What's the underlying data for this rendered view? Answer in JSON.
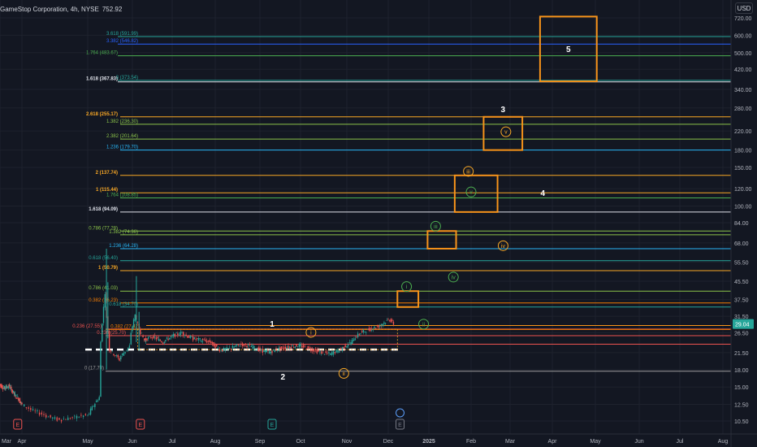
{
  "header": {
    "symbol": "GameStop Corporation, 4h, NYSE",
    "last_value": "752.92"
  },
  "currency_button": "USD",
  "current_price_label": "29.04",
  "colors": {
    "background": "#131722",
    "grid": "#1e222d",
    "orange": "#f7931a",
    "green": "#26a69a",
    "red": "#ef5350"
  },
  "chart_data": {
    "type": "candlestick",
    "price_scale": "log",
    "y_ticks": [
      "720.00",
      "600.00",
      "500.00",
      "420.00",
      "340.00",
      "280.00",
      "220.00",
      "180.00",
      "150.00",
      "120.00",
      "100.00",
      "84.00",
      "68.00",
      "55.50",
      "45.50",
      "37.50",
      "31.50",
      "26.50",
      "21.50",
      "18.00",
      "15.00",
      "12.50",
      "10.50"
    ],
    "x_ticks": [
      "Mar",
      "Apr",
      "May",
      "Jun",
      "Jul",
      "Aug",
      "Sep",
      "Oct",
      "Nov",
      "Dec",
      "2025",
      "Feb",
      "Mar",
      "Apr",
      "May",
      "Jun",
      "Jul",
      "Aug"
    ],
    "price_path": [
      [
        "2024-03-01",
        15.5
      ],
      [
        "2024-03-08",
        14.8
      ],
      [
        "2024-03-15",
        15.2
      ],
      [
        "2024-03-22",
        14.0
      ],
      [
        "2024-03-29",
        13.2
      ],
      [
        "2024-04-05",
        12.0
      ],
      [
        "2024-04-12",
        11.2
      ],
      [
        "2024-04-19",
        10.6
      ],
      [
        "2024-04-26",
        10.9
      ],
      [
        "2024-05-03",
        11.2
      ],
      [
        "2024-05-10",
        13.5
      ],
      [
        "2024-05-14",
        40.0
      ],
      [
        "2024-05-17",
        22.5
      ],
      [
        "2024-05-24",
        20.0
      ],
      [
        "2024-05-31",
        23.0
      ],
      [
        "2024-06-04",
        32.0
      ],
      [
        "2024-06-07",
        28.0
      ],
      [
        "2024-06-11",
        24.5
      ],
      [
        "2024-06-18",
        25.5
      ],
      [
        "2024-06-25",
        24.0
      ],
      [
        "2024-07-02",
        25.5
      ],
      [
        "2024-07-09",
        26.5
      ],
      [
        "2024-07-16",
        25.0
      ],
      [
        "2024-07-23",
        24.5
      ],
      [
        "2024-07-30",
        24.0
      ],
      [
        "2024-08-06",
        22.0
      ],
      [
        "2024-08-13",
        22.5
      ],
      [
        "2024-08-20",
        23.5
      ],
      [
        "2024-08-27",
        23.0
      ],
      [
        "2024-09-03",
        22.0
      ],
      [
        "2024-09-10",
        21.6
      ],
      [
        "2024-09-17",
        22.5
      ],
      [
        "2024-09-24",
        22.8
      ],
      [
        "2024-10-01",
        23.2
      ],
      [
        "2024-10-08",
        22.5
      ],
      [
        "2024-10-15",
        21.6
      ],
      [
        "2024-10-22",
        21.2
      ],
      [
        "2024-10-29",
        22.2
      ],
      [
        "2024-11-05",
        24.0
      ],
      [
        "2024-11-12",
        26.5
      ],
      [
        "2024-11-19",
        27.5
      ],
      [
        "2024-11-26",
        28.5
      ],
      [
        "2024-12-03",
        30.5
      ],
      [
        "2024-12-06",
        29.04
      ]
    ],
    "fib_levels": [
      {
        "label": "3.618 (591.99)",
        "price": 592,
        "color": "#26a69a"
      },
      {
        "label": "3.382 (546.82)",
        "price": 547,
        "color": "#2962ff"
      },
      {
        "label": "1.764 (483.67)",
        "price": 484,
        "color": "#4caf50"
      },
      {
        "label": "1.618 (367.83)",
        "price": 368,
        "color": "#e0e3eb"
      },
      {
        "label": "3 (373.54)",
        "price": 374,
        "color": "#26a69a"
      },
      {
        "label": "2.618 (255.17)",
        "price": 255,
        "color": "#f9a825"
      },
      {
        "label": "1.382 (236.30)",
        "price": 236,
        "color": "#8bc34a"
      },
      {
        "label": "2.382 (201.64)",
        "price": 202,
        "color": "#8bc34a"
      },
      {
        "label": "1.236 (179.70)",
        "price": 180,
        "color": "#29b6f6"
      },
      {
        "label": "2 (137.74)",
        "price": 138,
        "color": "#f9a825"
      },
      {
        "label": "1 (115.44)",
        "price": 115,
        "color": "#f9a825"
      },
      {
        "label": "1.764 (108.85)",
        "price": 109,
        "color": "#4caf50"
      },
      {
        "label": "1.618 (94.09)",
        "price": 94,
        "color": "#e0e3eb"
      },
      {
        "label": "0.786 (77.28)",
        "price": 77,
        "color": "#8bc34a"
      },
      {
        "label": "1.382 (74.36)",
        "price": 74,
        "color": "#8bc34a"
      },
      {
        "label": "1.236 (64.28)",
        "price": 64,
        "color": "#29b6f6"
      },
      {
        "label": "0.618 (56.40)",
        "price": 56.4,
        "color": "#26a69a"
      },
      {
        "label": "1 (50.79)",
        "price": 50.8,
        "color": "#f9a825"
      },
      {
        "label": "0.786 (41.03)",
        "price": 41,
        "color": "#8bc34a"
      },
      {
        "label": "0.382 (36.23)",
        "price": 36.2,
        "color": "#f57c00"
      },
      {
        "label": "0.618 (34.70)",
        "price": 34.7,
        "color": "#26a69a"
      },
      {
        "label": "0.236 (27.55)",
        "price": 27.55,
        "color": "#ef5350"
      },
      {
        "label": "0.382 (27.42)",
        "price": 27.42,
        "color": "#f57c00"
      },
      {
        "label": "0.236 (25.70)",
        "price": 25.7,
        "color": "#ef5350"
      },
      {
        "label": "0 (17.70)",
        "price": 17.7,
        "color": "#9e9e9e"
      }
    ],
    "target_boxes": [
      {
        "label": "5",
        "d1": "2025-03-23",
        "d2": "2025-05-02",
        "p1": 370,
        "p2": 730
      },
      {
        "label": "3",
        "d1": "2025-02-10",
        "d2": "2025-03-10",
        "p1": 180,
        "p2": 255
      },
      {
        "label": "",
        "d1": "2025-01-20",
        "d2": "2025-02-20",
        "p1": 94,
        "p2": 138
      },
      {
        "label": "",
        "d1": "2024-12-31",
        "d2": "2025-01-21",
        "p1": 64,
        "p2": 77
      },
      {
        "label": "",
        "d1": "2024-12-08",
        "d2": "2024-12-24",
        "p1": 34.7,
        "p2": 41
      }
    ],
    "wave_labels": [
      {
        "text": "1",
        "date": "2024-09-10",
        "price": 29.2,
        "style": "plain"
      },
      {
        "text": "2",
        "date": "2024-09-18",
        "price": 16.8,
        "style": "plain"
      },
      {
        "text": "4",
        "date": "2025-03-25",
        "price": 115,
        "style": "plain"
      },
      {
        "text": "i",
        "date": "2024-10-08",
        "price": 26.6,
        "style": "circle-orange"
      },
      {
        "text": "ii",
        "date": "2024-10-30",
        "price": 17.3,
        "style": "circle-orange"
      },
      {
        "text": "iii",
        "date": "2025-01-30",
        "price": 144,
        "style": "circle-orange"
      },
      {
        "text": "iv",
        "date": "2025-02-24",
        "price": 66,
        "style": "circle-orange"
      },
      {
        "text": "v",
        "date": "2025-02-26",
        "price": 218,
        "style": "circle-orange"
      },
      {
        "text": "i",
        "date": "2024-12-15",
        "price": 43,
        "style": "circle-green"
      },
      {
        "text": "ii",
        "date": "2024-12-28",
        "price": 29,
        "style": "circle-green"
      },
      {
        "text": "iii",
        "date": "2025-01-06",
        "price": 81,
        "style": "circle-green"
      },
      {
        "text": "iv",
        "date": "2025-01-19",
        "price": 47.5,
        "style": "circle-green"
      },
      {
        "text": "v",
        "date": "2025-02-01",
        "price": 116,
        "style": "circle-green"
      }
    ],
    "earnings_markers": [
      {
        "text": "E",
        "date": "2024-03-26",
        "color": "#ef5350"
      },
      {
        "text": "E",
        "date": "2024-06-07",
        "color": "#ef5350"
      },
      {
        "text": "E",
        "date": "2024-09-10",
        "color": "#26a69a"
      },
      {
        "text": "E",
        "date": "2024-12-10",
        "color": "#787b86"
      }
    ],
    "dashed_line_price": 22.2
  }
}
